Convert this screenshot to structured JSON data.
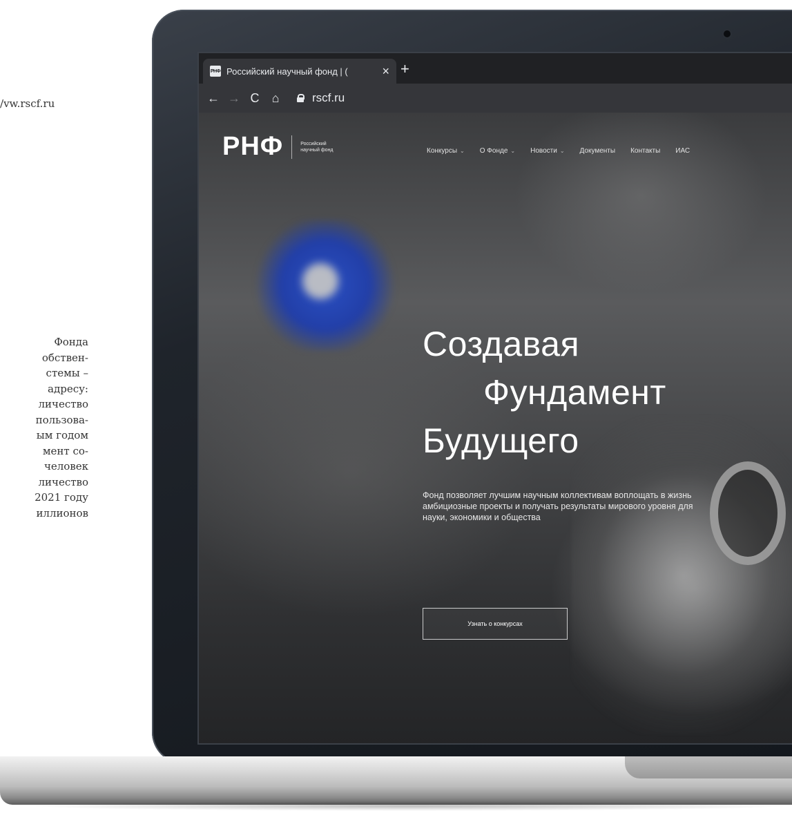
{
  "side_text": {
    "url_fragment": "vw.rscf.ru/",
    "paragraph_lines": [
      "Фонда",
      "обствен-",
      "стемы –",
      "адресу:",
      "личество",
      "пользова-",
      "ым годом",
      "мент со-",
      "человек",
      "личество",
      "2021 году",
      "иллионов"
    ]
  },
  "browser": {
    "tab_title": "Российский научный фонд | (",
    "favicon_text": "РНФ",
    "close_glyph": "×",
    "new_tab_glyph": "+",
    "back_glyph": "←",
    "forward_glyph": "→",
    "reload_glyph": "C",
    "home_glyph": "⌂",
    "url": "rscf.ru"
  },
  "site": {
    "logo_mark": "РНФ",
    "logo_text": "Российский научный фонд",
    "nav": [
      {
        "label": "Конкурсы",
        "chevron": "⌄"
      },
      {
        "label": "О Фонде",
        "chevron": "⌄"
      },
      {
        "label": "Новости",
        "chevron": "⌄"
      },
      {
        "label": "Документы",
        "chevron": ""
      },
      {
        "label": "Контакты",
        "chevron": ""
      },
      {
        "label": "ИАС",
        "chevron": ""
      }
    ],
    "hero_title_lines": [
      "Создавая",
      "Фундамент",
      "Будущего"
    ],
    "hero_subtitle": "Фонд позволяет лучшим научным коллективам воплощать в жизнь амбициозные проекты и получать результаты мирового уровня для науки, экономики и общества",
    "cta_label": "Узнать о конкурсах"
  },
  "colors": {
    "laptop_bezel": "#1f242b",
    "browser_tabbar": "#202124",
    "browser_toolbar": "#35363a",
    "hero_text": "#ffffff",
    "gear_accent": "#2a4fc2"
  }
}
